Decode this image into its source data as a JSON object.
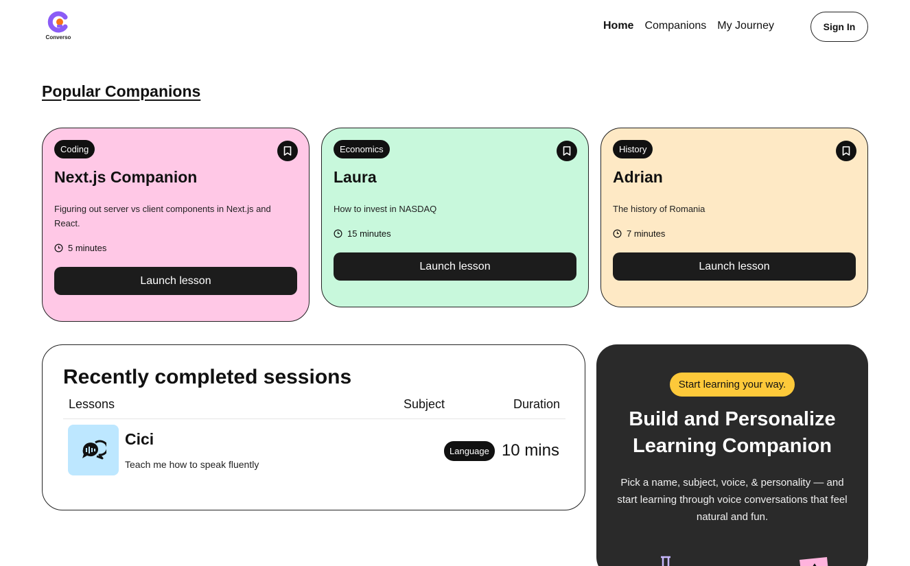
{
  "brand": {
    "name": "Converso",
    "accent": "#8b5cf6",
    "accent2": "#f97316"
  },
  "nav": {
    "items": [
      "Home",
      "Companions",
      "My Journey"
    ],
    "active": "Home",
    "sign_in": "Sign In"
  },
  "popular": {
    "title": "Popular Companions",
    "cards": [
      {
        "subject": "Coding",
        "name": "Next.js Companion",
        "topic": "Figuring out server vs client components in Next.js and React.",
        "duration": "5 minutes",
        "button": "Launch lesson",
        "color": "#ffc8e6"
      },
      {
        "subject": "Economics",
        "name": "Laura",
        "topic": "How to invest in NASDAQ",
        "duration": "15 minutes",
        "button": "Launch lesson",
        "color": "#c8f8dc"
      },
      {
        "subject": "History",
        "name": "Adrian",
        "topic": "The history of Romania",
        "duration": "7 minutes",
        "button": "Launch lesson",
        "color": "#fee9c5"
      }
    ]
  },
  "recent": {
    "title": "Recently completed sessions",
    "columns": [
      "Lessons",
      "Subject",
      "Duration"
    ],
    "rows": [
      {
        "icon": "language-chat-icon",
        "name": "Cici",
        "topic": "Teach me how to speak fluently",
        "subject": "Language",
        "duration": "10 mins"
      }
    ]
  },
  "cta": {
    "tag": "Start learning your way.",
    "title": "Build and Personalize Learning Companion",
    "description": "Pick a name, subject, voice, & personality — and start learning through voice conversations that feel natural and fun."
  }
}
